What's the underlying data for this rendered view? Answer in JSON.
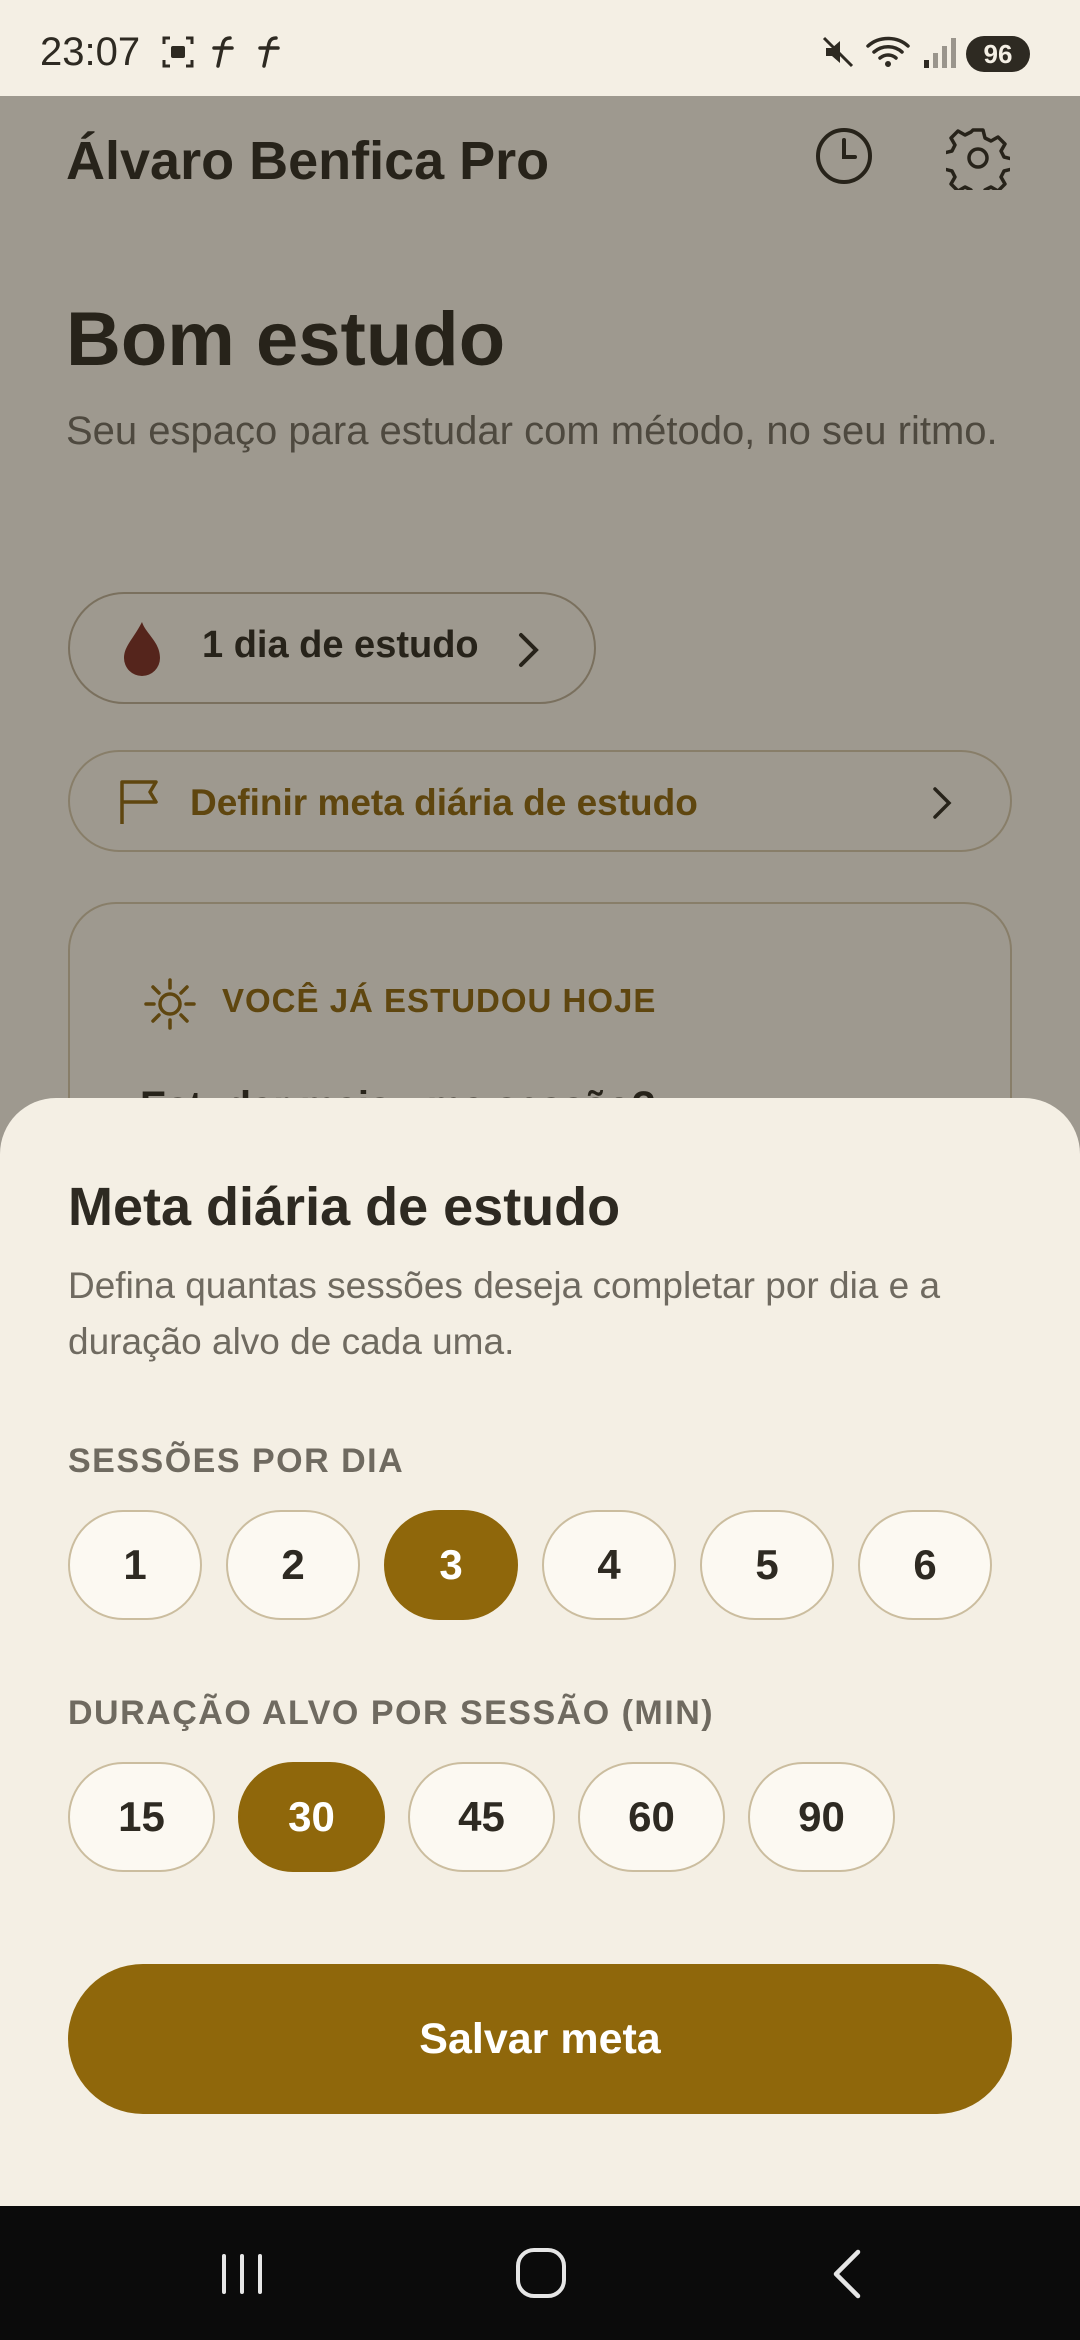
{
  "status_bar": {
    "time": "23:07",
    "battery": "96",
    "icons": [
      "screenshot-icon",
      "fbox-icon",
      "fbox-icon",
      "mute-icon",
      "wifi-icon",
      "signal-icon"
    ]
  },
  "app": {
    "title": "Álvaro Benfica Pro",
    "greeting": "Bom estudo",
    "subtitle": "Seu espaço para estudar com método, no seu ritmo.",
    "streak_label": "1 dia de estudo",
    "goal_link_label": "Definir meta diária de estudo",
    "today_card": {
      "label": "VOCÊ JÁ ESTUDOU HOJE",
      "peek": "Estudar mais uma sessão?"
    }
  },
  "sheet": {
    "title": "Meta diária de estudo",
    "description": "Defina quantas sessões deseja completar por dia e a duração alvo de cada uma.",
    "sessions_label": "SESSÕES POR DIA",
    "sessions_options": [
      "1",
      "2",
      "3",
      "4",
      "5",
      "6"
    ],
    "sessions_selected": "3",
    "duration_label": "DURAÇÃO ALVO POR SESSÃO (MIN)",
    "duration_options": [
      "15",
      "30",
      "45",
      "60",
      "90"
    ],
    "duration_selected": "30",
    "save_label": "Salvar meta"
  },
  "colors": {
    "accent": "#8f670b",
    "background": "#f4efe4",
    "text": "#2e2a22",
    "muted_text": "#6f6a60",
    "chip_border": "#cbbd9f"
  }
}
